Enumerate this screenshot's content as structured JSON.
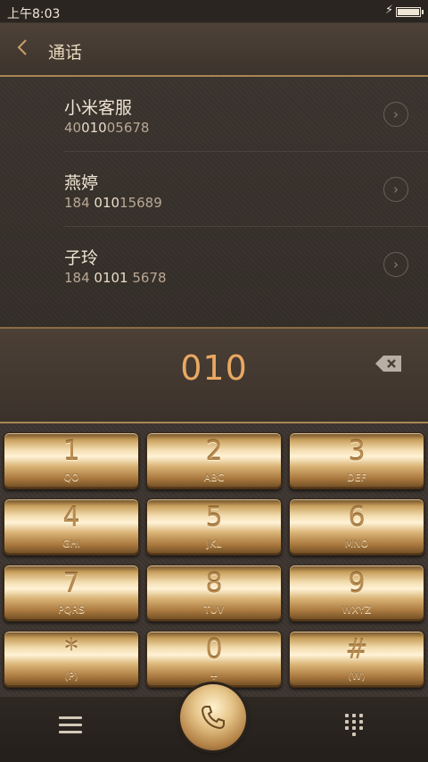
{
  "status_bar": {
    "time": "上午8:03",
    "battery_level": 1.0
  },
  "header": {
    "title": "通话"
  },
  "contacts": [
    {
      "name": "小米客服",
      "number_pre": "40",
      "number_hl": "010",
      "number_post": "05678"
    },
    {
      "name": "燕婷",
      "number_pre": "184 ",
      "number_hl": "010",
      "number_post": "15689"
    },
    {
      "name": "子玲",
      "number_pre": "184 ",
      "number_hl": "0101",
      "number_post": " 5678"
    }
  ],
  "dial_input": {
    "value": "010"
  },
  "keys": [
    {
      "digit": "1",
      "letters": "QO"
    },
    {
      "digit": "2",
      "letters": "ABC"
    },
    {
      "digit": "3",
      "letters": "DEF"
    },
    {
      "digit": "4",
      "letters": "GHI"
    },
    {
      "digit": "5",
      "letters": "JKL"
    },
    {
      "digit": "6",
      "letters": "MNO"
    },
    {
      "digit": "7",
      "letters": "PQRS"
    },
    {
      "digit": "8",
      "letters": "TUV"
    },
    {
      "digit": "9",
      "letters": "WXYZ"
    },
    {
      "digit": "*",
      "letters": "(P)"
    },
    {
      "digit": "0",
      "letters": "+"
    },
    {
      "digit": "#",
      "letters": "(W)"
    }
  ],
  "icons": {
    "back": "chevron-left-icon",
    "menu": "menu-icon",
    "call": "phone-icon",
    "keypad_toggle": "dialpad-icon",
    "backspace": "backspace-icon"
  },
  "colors": {
    "accent": "#e9a862",
    "gold": "#c9a06a",
    "background": "#3a332d"
  }
}
